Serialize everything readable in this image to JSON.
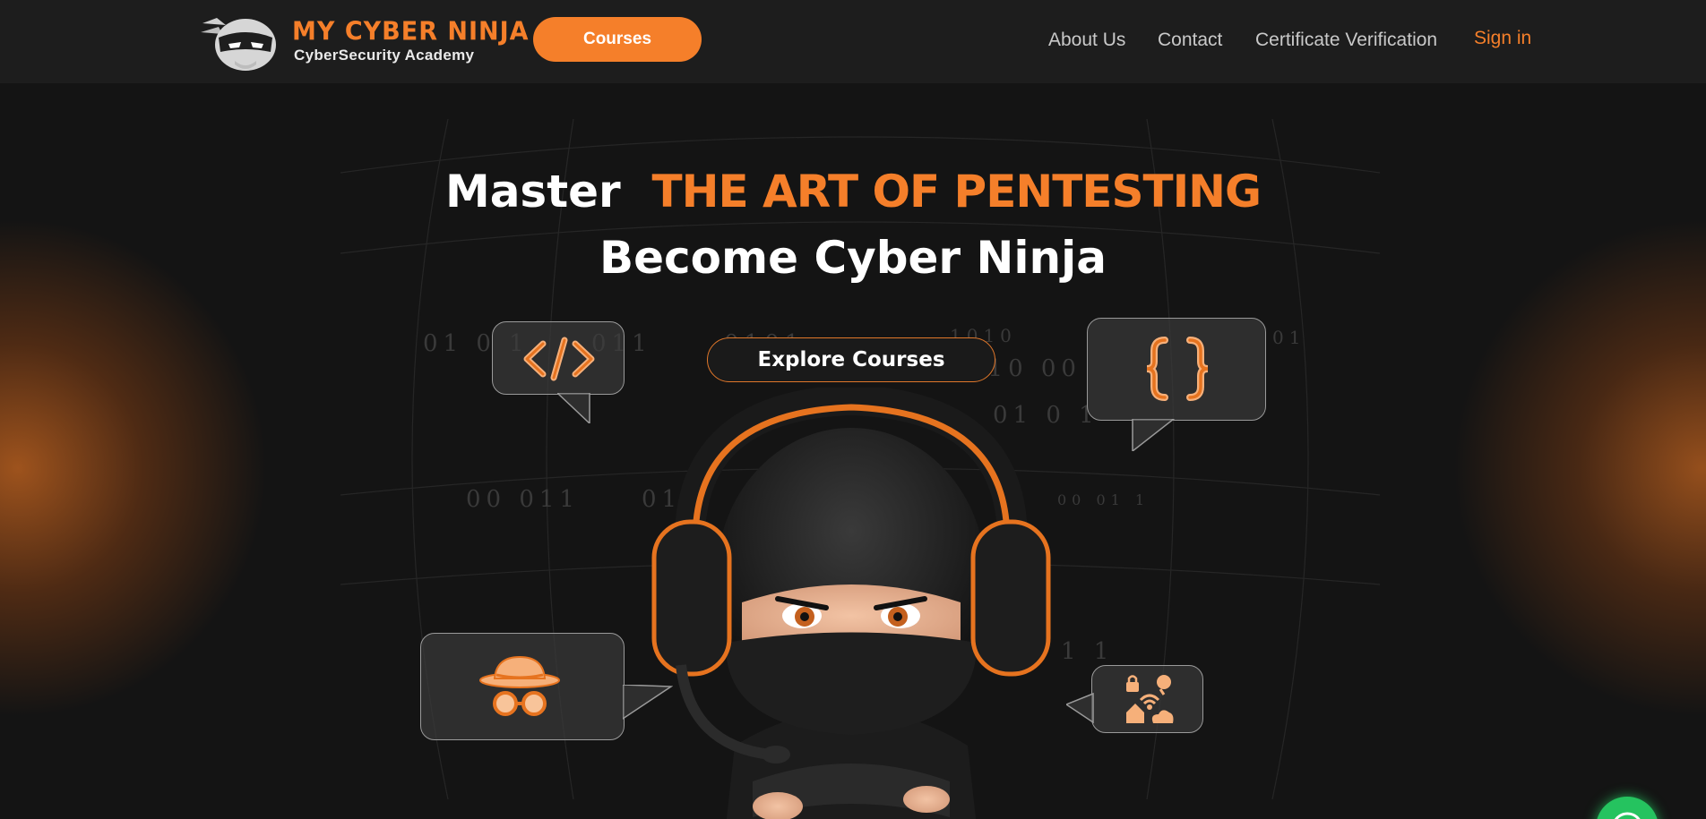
{
  "nav": {
    "brand": "MY CYBER NINJA",
    "tagline": "CyberSecurity Academy",
    "courses_label": "Courses",
    "links": [
      "About Us",
      "Contact",
      "Certificate Verification"
    ],
    "signin_label": "Sign in"
  },
  "hero": {
    "headline_lead": "Master",
    "headline_accent": "THE ART OF PENTESTING",
    "subhead": "Become Cyber Ninja",
    "cta_label": "Explore Courses",
    "binary": [
      "01 0 1",
      "011",
      "0101",
      "1010",
      "110 00",
      "01 0 1",
      "00 011",
      "011",
      "1 1",
      "01",
      "00 01 1"
    ]
  },
  "colors": {
    "accent": "#f57f2a",
    "nav_bg": "#1d1d1d",
    "page_bg": "#141414",
    "whatsapp": "#25c35f"
  },
  "icons": [
    "code-tag-icon",
    "curly-braces-icon",
    "spy-hat-glasses-icon",
    "network-devices-icon",
    "whatsapp-icon"
  ]
}
